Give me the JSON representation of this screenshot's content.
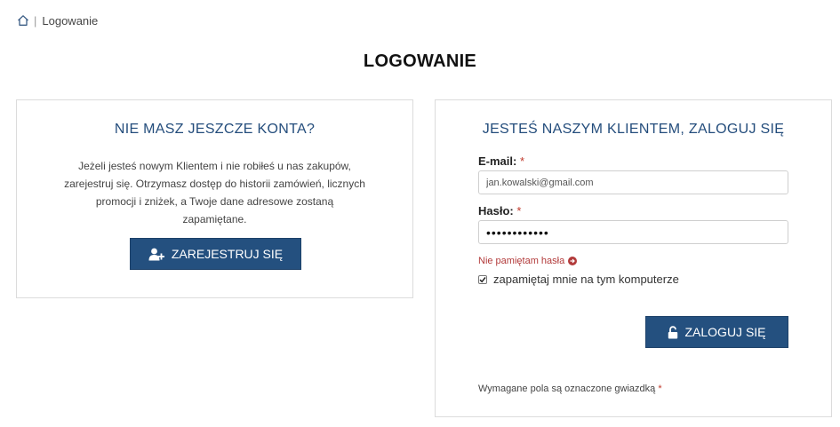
{
  "breadcrumb": {
    "home_icon": "home-icon",
    "separator": "|",
    "current": "Logowanie"
  },
  "page": {
    "title": "LOGOWANIE"
  },
  "register_panel": {
    "heading": "NIE MASZ JESZCZE KONTA?",
    "intro": "Jeżeli jesteś nowym Klientem i nie robiłeś u nas zakupów, zarejestruj się. Otrzymasz dostęp do historii zamówień, licznych promocji i zniżek, a Twoje dane adresowe zostaną zapamiętane.",
    "button_label": "ZAREJESTRUJ SIĘ",
    "button_icon": "user-plus-icon"
  },
  "login_panel": {
    "heading": "JESTEŚ NASZYM KLIENTEM, ZALOGUJ SIĘ",
    "email_label": "E-mail:",
    "email_value": "jan.kowalski@gmail.com",
    "password_label": "Hasło:",
    "password_value": "••••••••••••",
    "required_marker": "*",
    "forgot_label": "Nie pamiętam hasła",
    "forgot_icon": "arrow-circle-right-icon",
    "remember_label": "zapamiętaj mnie na tym komputerze",
    "remember_checked": true,
    "login_button_label": "ZALOGUJ SIĘ",
    "login_button_icon": "unlock-icon",
    "required_note": "Wymagane pola są oznaczone gwiazdką"
  },
  "colors": {
    "accent": "#244d7c",
    "button": "#24507f",
    "required": "#c0392b",
    "link": "#b23a3a"
  }
}
